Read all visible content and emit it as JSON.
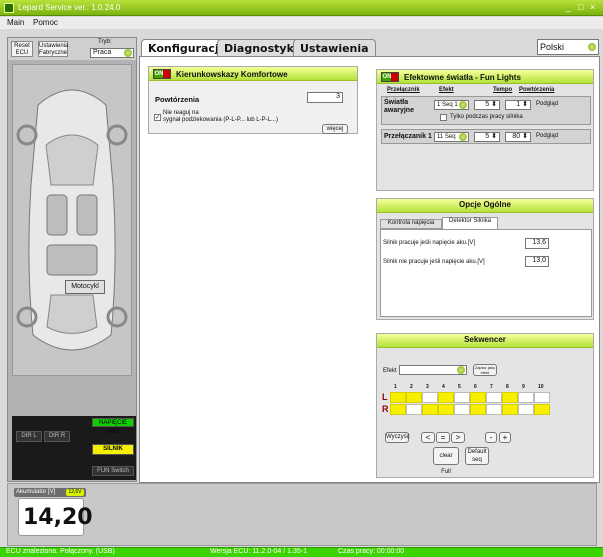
{
  "window": {
    "title": "Lepard Service  ver.: 1.0.24.0",
    "controls": [
      "_",
      "□",
      "×"
    ]
  },
  "menu": {
    "main": "Main",
    "help": "Pomoc"
  },
  "left": {
    "reset_ecu": "Reset ECU",
    "factory_settings": "Ustawienia Fabryczne",
    "mode_label": "Tryb:",
    "mode_value": "Praca",
    "moto_button": "Motocykl",
    "status": {
      "battery_voltage": "NAPIĘCIE AKU",
      "dir_l": "DIR L",
      "dir_r": "DIR R",
      "engine": "SILNIK",
      "fun_switch": "FUN Switch"
    }
  },
  "tabs": [
    {
      "label": "Konfiguracja",
      "active": true
    },
    {
      "label": "Diagnostyka",
      "active": false
    },
    {
      "label": "Ustawienia",
      "active": false
    }
  ],
  "language": "Polski",
  "comfort": {
    "on_label": "ON",
    "title": "Kierunkowskazy Komfortowe",
    "repeats_label": "Powtórzenia",
    "repeats_value": "3",
    "ignore_label": "Nie reaguj na\nsygnał podziekowania (P-L-P... lub L-P-L...)",
    "more_button": "więcej"
  },
  "fun_lights": {
    "on_label": "ON",
    "title": "Efektowne światła - Fun Lights",
    "headers": {
      "switch": "Przełącznik",
      "effect": "Efekt",
      "tempo": "Tempo",
      "repeats": "Powtórzenia"
    },
    "hazard": {
      "label": "Światła awaryjne",
      "effect": "1 Seq 1",
      "tempo": "5",
      "repeats": "1",
      "preview": "Podgląd",
      "only_engine": "Tylko podczas pracy silnika"
    },
    "switch1": {
      "label": "Przełączanik 1",
      "effect": "11 Seq",
      "tempo": "5",
      "repeats": "80",
      "preview": "Podgląd"
    }
  },
  "general": {
    "title": "Opcje Ogólne",
    "tabs": [
      "Kontrola napięcia",
      "Detektor Silnika"
    ],
    "engine_on_label": "Silnik pracuje jeśli napięcie aku.[V]",
    "engine_on_value": "13,6",
    "engine_off_label": "Silnik nie pracuje jeśli napięcie aku.[V]",
    "engine_off_value": "13,0"
  },
  "sequencer": {
    "title": "Sekwencer",
    "effect_label": "Efekt",
    "effect_value": "",
    "save_button": "Zapisz jako efekt",
    "cols": [
      "1",
      "2",
      "3",
      "4",
      "5",
      "6",
      "7",
      "8",
      "9",
      "10"
    ],
    "rows": [
      "L",
      "R"
    ],
    "pattern": [
      [
        1,
        1,
        0,
        1,
        0,
        1,
        0,
        1,
        0,
        0
      ],
      [
        1,
        0,
        1,
        1,
        0,
        1,
        0,
        1,
        0,
        1
      ]
    ],
    "clear": "Wyczyść",
    "left": "<",
    "equal": "=",
    "right": ">",
    "minus": "-",
    "plus": "+",
    "clear_full": "clear Full",
    "default_seq": "Default seq"
  },
  "battery": {
    "label": "Akumulator [V]",
    "badge": "12,6V",
    "value": "14,20"
  },
  "statusbar": {
    "connection": "ECU znaleziona. Połączony. (USB)",
    "ecu_version": "Wersja ECU: 11.2.0-04 / 1.35-1",
    "uptime": "Czas pracy: 00:00:00"
  }
}
